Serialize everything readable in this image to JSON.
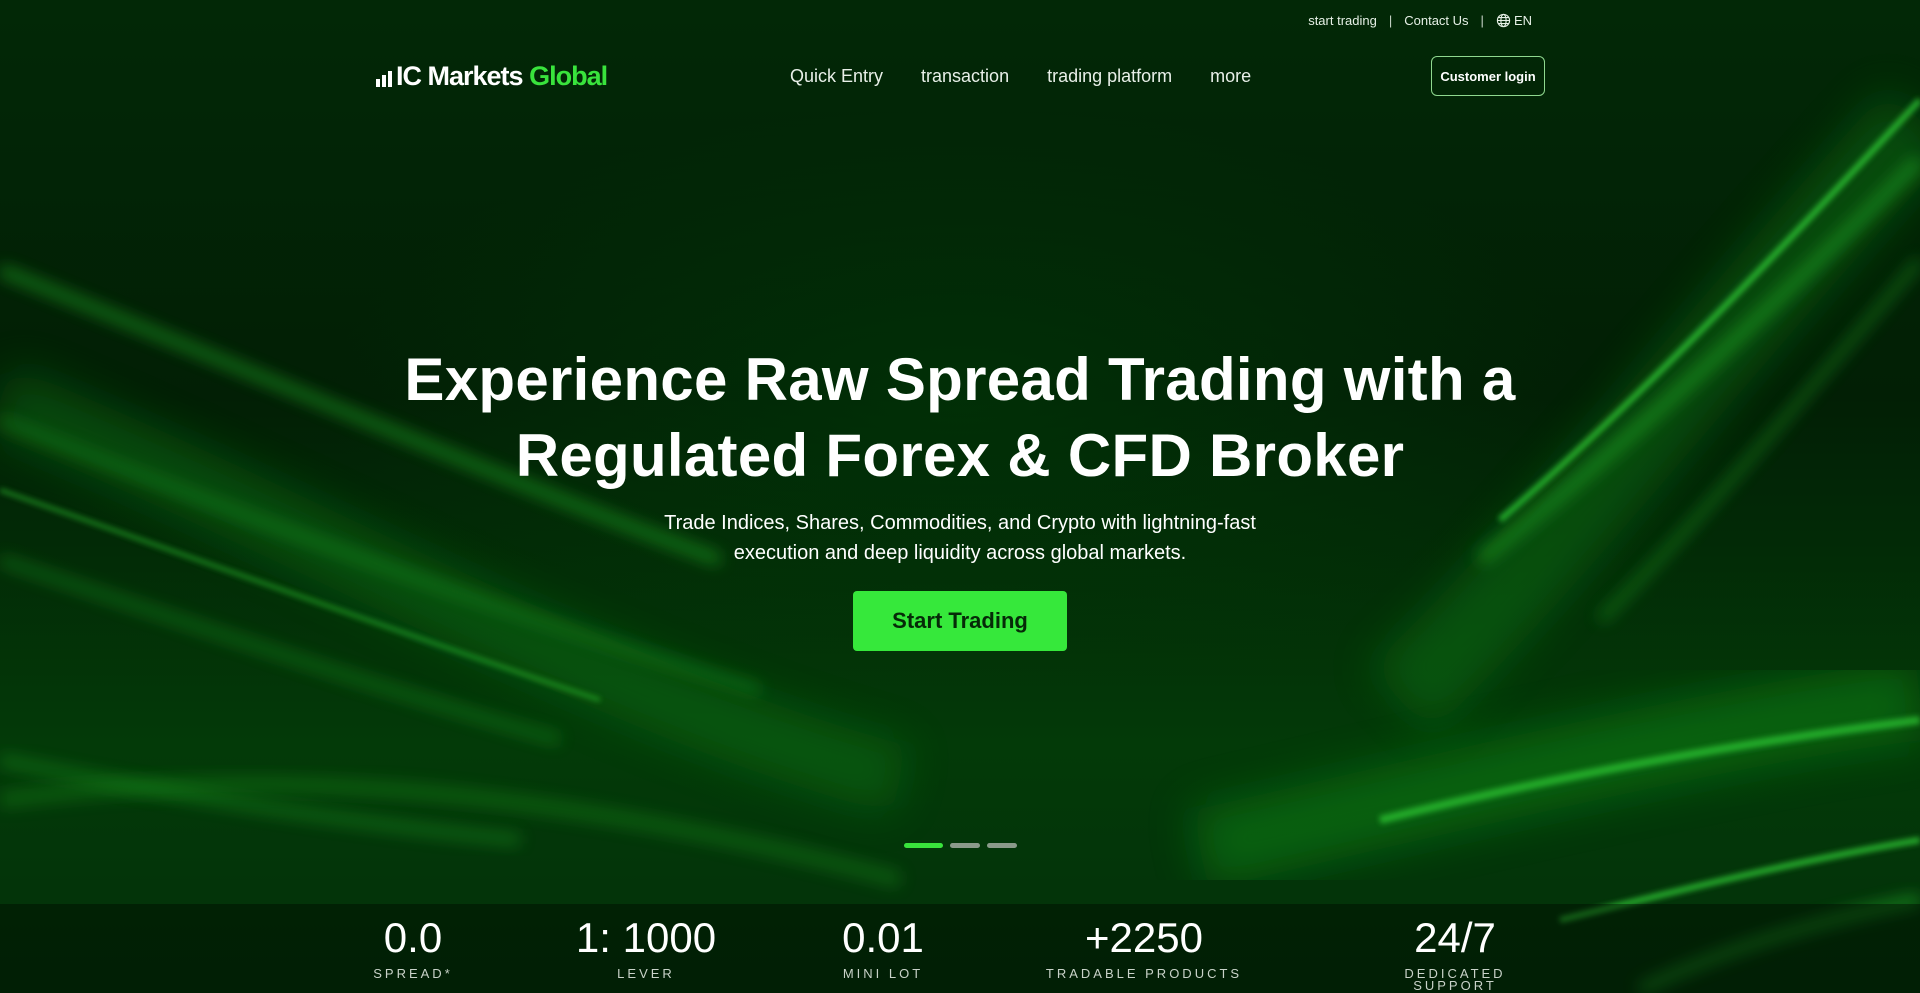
{
  "utility_bar": {
    "start_trading": "start trading",
    "contact_us": "Contact Us",
    "separator": "|",
    "language": "EN",
    "language_icon": "globe-icon"
  },
  "logo": {
    "part1": "IC Markets",
    "part2": "Global",
    "icon": "signal-bars-icon"
  },
  "nav": {
    "items": [
      "Quick Entry",
      "transaction",
      "trading platform",
      "more"
    ]
  },
  "header": {
    "login_label": "Customer login"
  },
  "hero": {
    "headline_line1": "Experience Raw Spread Trading with a",
    "headline_line2": "Regulated Forex & CFD Broker",
    "subline_line1": "Trade Indices, Shares, Commodities, and Crypto with lightning-fast",
    "subline_line2": "execution and deep liquidity across global markets.",
    "cta_label": "Start Trading",
    "slide_count": 3,
    "active_slide": 1
  },
  "stats": [
    {
      "value": "0.0",
      "label": "SPREAD*"
    },
    {
      "value": "1: 1000",
      "label": "LEVER"
    },
    {
      "value": "0.01",
      "label": "MINI LOT"
    },
    {
      "value": "+2250",
      "label": "TRADABLE PRODUCTS"
    },
    {
      "value": "24/7",
      "label": "DEDICATED SUPPORT"
    }
  ],
  "colors": {
    "accent": "#36e83b",
    "background": "#021f05",
    "text": "#ffffff"
  }
}
